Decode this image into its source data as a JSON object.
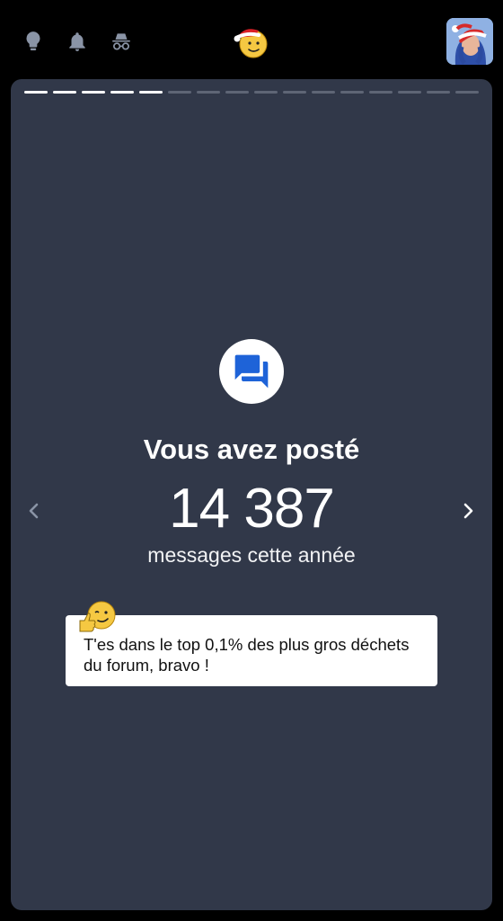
{
  "topbar": {
    "icons": [
      "lightbulb-icon",
      "bell-icon",
      "incognito-icon"
    ],
    "logo": "santa-smiley-logo",
    "avatar": "user-avatar"
  },
  "story": {
    "progress": {
      "total_segments": 16,
      "completed_segments": 5
    },
    "icon": "forum-chat-icon",
    "headline": "Vous avez posté",
    "count": "14 387",
    "subtitle": "messages cette année",
    "comment": "T'es dans le top 0,1% des plus gros déchets du forum, bravo !",
    "comment_emoji": "thumbs-up-wink-smiley",
    "prev_icon": "chevron-left-icon",
    "next_icon": "chevron-right-icon"
  },
  "colors": {
    "background": "#000000",
    "card": "#313849",
    "accent_blue": "#1e63d8",
    "icon_gray": "#8a94a6"
  }
}
